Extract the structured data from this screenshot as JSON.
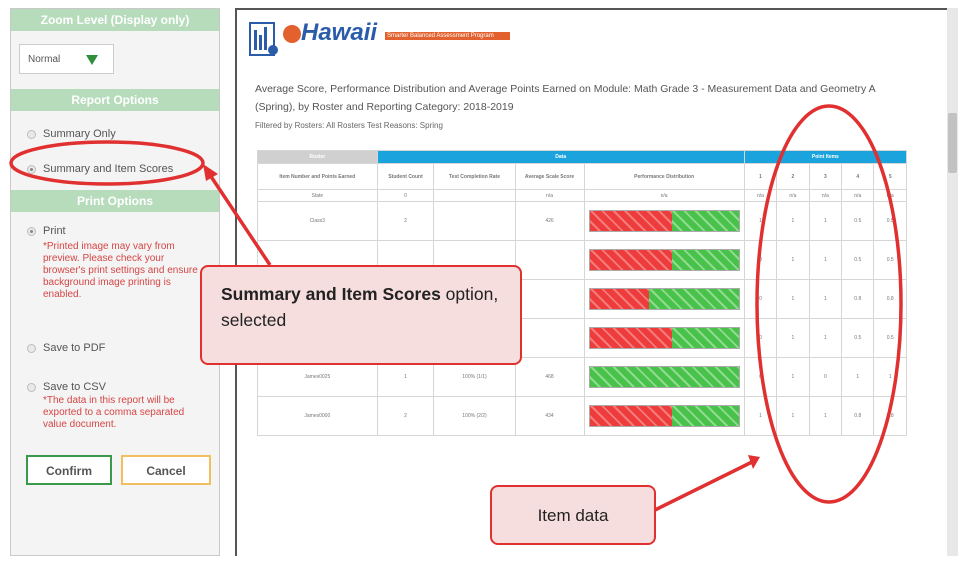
{
  "left_panel": {
    "zoom_header": "Zoom Level (Display only)",
    "zoom_value": "Normal",
    "report_header": "Report Options",
    "report_options": [
      "Summary Only",
      "Summary and Item Scores"
    ],
    "print_header": "Print Options",
    "print_option": "Print",
    "print_warning": "*Printed image may vary from preview. Please check your browser's print settings and ensure background image printing is enabled.",
    "save_pdf": "Save to PDF",
    "save_csv": "Save to CSV",
    "csv_warning": "*The data in this report will be exported to a comma separated value document.",
    "confirm_label": "Confirm",
    "cancel_label": "Cancel"
  },
  "report": {
    "logo_text": "Hawaii",
    "logo_subtext": "Smarter Balanced Assessment Program",
    "title_line1": "Average Score, Performance Distribution and Average Points Earned on Module: Math Grade 3 - Measurement Data and Geometry A",
    "title_line2": "(Spring), by Roster and Reporting Category: 2018-2019",
    "filter": "Filtered by Rosters: All Rosters  Test Reasons: Spring",
    "table": {
      "group_headers": [
        "Roster",
        "Data",
        "Point Items"
      ],
      "columns": [
        "Item Number and Points Earned",
        "Student Count",
        "Test Completion Rate",
        "Average Scale Score",
        "Performance Distribution"
      ],
      "item_columns": [
        "1",
        "2",
        "3",
        "4",
        "5"
      ],
      "state_row": [
        "State",
        "0",
        "",
        "n/a",
        "n/a"
      ],
      "state_items": [
        "n/a",
        "n/a",
        "n/a",
        "n/a",
        "n/a"
      ],
      "rows": [
        {
          "name": "Class3",
          "count": "2",
          "rate": "",
          "score": "426",
          "red": 0.55,
          "green": 0.45,
          "items": [
            "1",
            "1",
            "1",
            "0.5",
            "0.5"
          ]
        },
        {
          "name": "",
          "count": "",
          "rate": "",
          "score": "",
          "red": 0.55,
          "green": 0.45,
          "items": [
            "0",
            "1",
            "1",
            "0.5",
            "0.5"
          ]
        },
        {
          "name": "",
          "count": "",
          "rate": "",
          "score": "",
          "red": 0.4,
          "green": 0.6,
          "items": [
            "0",
            "1",
            "1",
            "0.8",
            "0.8"
          ]
        },
        {
          "name": "",
          "count": "",
          "rate": "",
          "score": "",
          "red": 0.55,
          "green": 0.45,
          "items": [
            "0",
            "1",
            "1",
            "0.5",
            "0.5"
          ]
        },
        {
          "name": "James0025",
          "count": "1",
          "rate": "100% (1/1)",
          "score": "468",
          "red": 0.0,
          "green": 1.0,
          "items": [
            "0",
            "1",
            "0",
            "1",
            "1"
          ]
        },
        {
          "name": "James0000",
          "count": "2",
          "rate": "100% (2/2)",
          "score": "434",
          "red": 0.55,
          "green": 0.45,
          "items": [
            "1",
            "1",
            "1",
            "0.8",
            "0.8"
          ]
        }
      ]
    }
  },
  "callouts": {
    "selected_bold": "Summary and Item Scores",
    "selected_normal": " option, selected",
    "item_data": "Item data"
  },
  "colors": {
    "accent": "#e03030",
    "header_green": "#b7dcbc",
    "table_blue": "#1aa3dc",
    "bad": "#ee3b3b",
    "good": "#48c24a"
  }
}
